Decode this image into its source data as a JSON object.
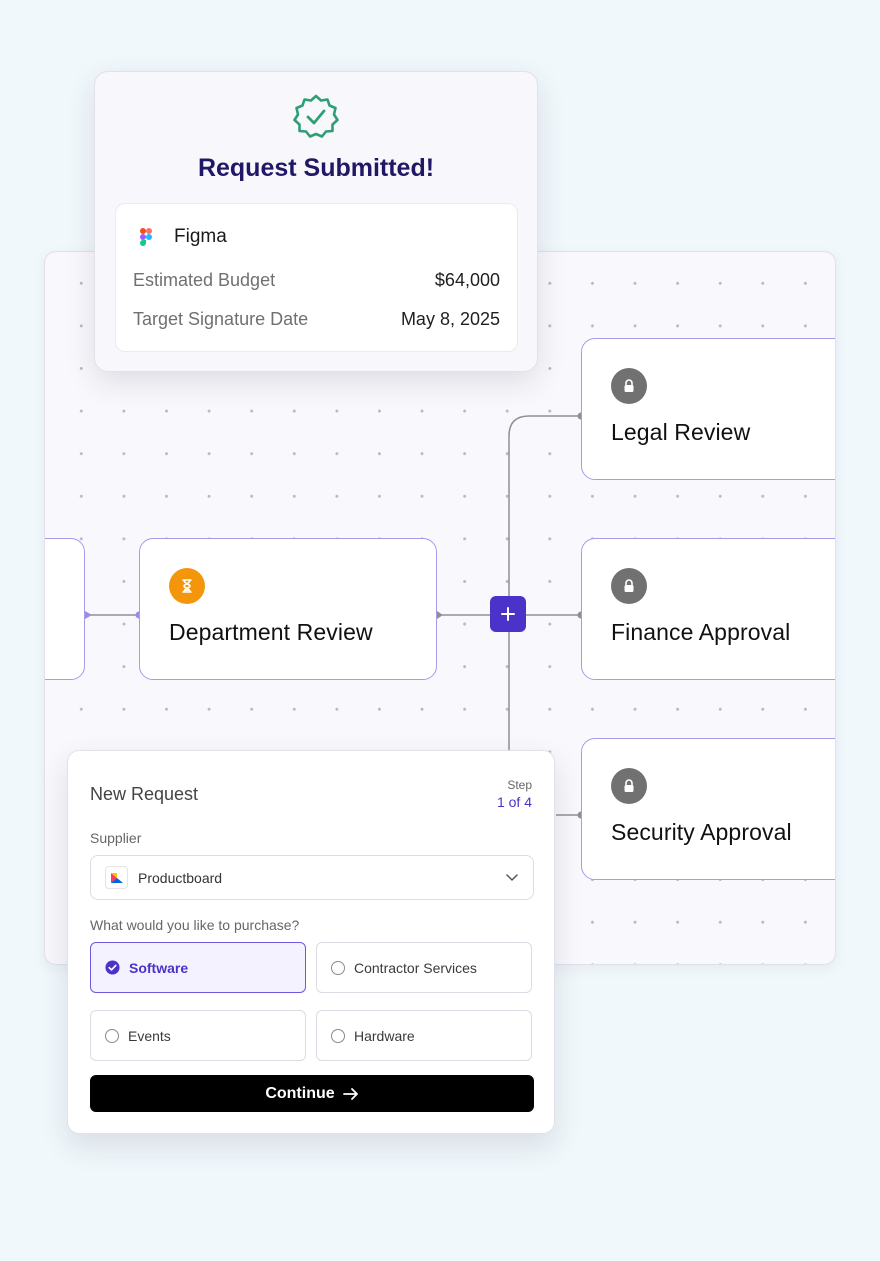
{
  "success_card": {
    "title": "Request Submitted!",
    "vendor": "Figma",
    "rows": [
      {
        "label": "Estimated Budget",
        "value": "$64,000"
      },
      {
        "label": "Target Signature Date",
        "value": "May 8, 2025"
      }
    ]
  },
  "workflow": {
    "nodes": [
      {
        "label": "Department Review",
        "status_icon": "hourglass-icon",
        "icon_color": "#f4960c"
      },
      {
        "label": "Legal Review",
        "status_icon": "lock-icon",
        "icon_color": "#717171"
      },
      {
        "label": "Finance Approval",
        "status_icon": "lock-icon",
        "icon_color": "#717171"
      },
      {
        "label": "Security Approval",
        "status_icon": "lock-icon",
        "icon_color": "#717171"
      }
    ],
    "add_step_icon": "plus-icon",
    "accent": "#4b32c8",
    "node_border": "#a69ce9"
  },
  "form": {
    "title": "New Request",
    "step_label": "Step",
    "step_value": "1 of 4",
    "supplier_label": "Supplier",
    "supplier_value": "Productboard",
    "purchase_question": "What would you like to purchase?",
    "options": [
      {
        "label": "Software",
        "selected": true
      },
      {
        "label": "Contractor Services",
        "selected": false
      },
      {
        "label": "Events",
        "selected": false
      },
      {
        "label": "Hardware",
        "selected": false
      }
    ],
    "continue_label": "Continue"
  }
}
